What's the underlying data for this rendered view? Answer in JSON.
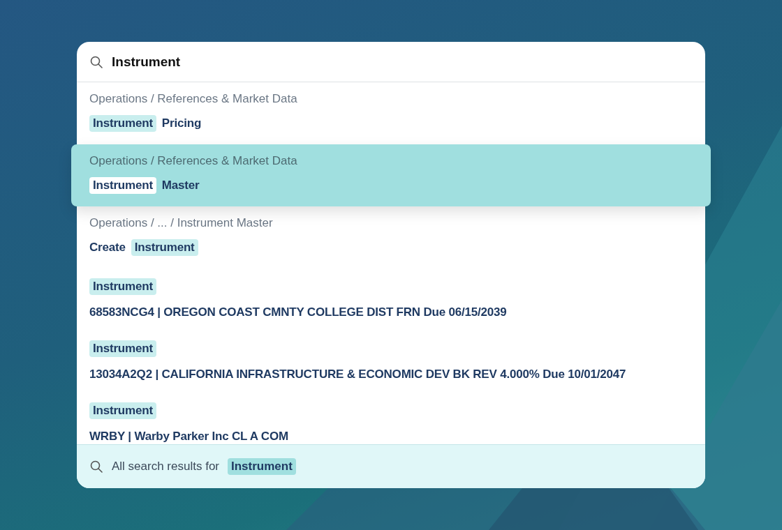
{
  "search": {
    "value": "Instrument"
  },
  "results": [
    {
      "selected": false,
      "lines": [
        {
          "kind": "path",
          "parts": [
            {
              "text": "Operations / References & Market Data",
              "match": false
            }
          ]
        },
        {
          "kind": "title",
          "parts": [
            {
              "text": "Instrument",
              "match": true
            },
            {
              "text": "Pricing",
              "match": false
            }
          ]
        }
      ]
    },
    {
      "selected": true,
      "lines": [
        {
          "kind": "path",
          "parts": [
            {
              "text": "Operations / References & Market Data",
              "match": false
            }
          ]
        },
        {
          "kind": "title",
          "parts": [
            {
              "text": "Instrument",
              "match": true
            },
            {
              "text": "Master",
              "match": false
            }
          ]
        }
      ]
    },
    {
      "selected": false,
      "lines": [
        {
          "kind": "path",
          "parts": [
            {
              "text": "Operations / ... / Instrument Master",
              "match": false
            }
          ]
        },
        {
          "kind": "title",
          "parts": [
            {
              "text": "Create",
              "match": false
            },
            {
              "text": "Instrument",
              "match": true
            }
          ]
        }
      ]
    },
    {
      "selected": false,
      "lines": [
        {
          "kind": "title",
          "parts": [
            {
              "text": "Instrument",
              "match": true
            }
          ]
        },
        {
          "kind": "title",
          "parts": [
            {
              "text": "68583NCG4 | OREGON COAST CMNTY COLLEGE DIST FRN Due 06/15/2039",
              "match": false
            }
          ]
        }
      ]
    },
    {
      "selected": false,
      "lines": [
        {
          "kind": "title",
          "parts": [
            {
              "text": "Instrument",
              "match": true
            }
          ]
        },
        {
          "kind": "title",
          "parts": [
            {
              "text": "13034A2Q2 | CALIFORNIA INFRASTRUCTURE & ECONOMIC DEV BK REV 4.000% Due 10/01/2047",
              "match": false
            }
          ]
        }
      ]
    },
    {
      "selected": false,
      "lines": [
        {
          "kind": "title",
          "parts": [
            {
              "text": "Instrument",
              "match": true
            }
          ]
        },
        {
          "kind": "title",
          "parts": [
            {
              "text": "WRBY | Warby Parker Inc CL A COM",
              "match": false
            }
          ]
        }
      ]
    }
  ],
  "footer": {
    "label": "All search results for",
    "query": "Instrument"
  }
}
